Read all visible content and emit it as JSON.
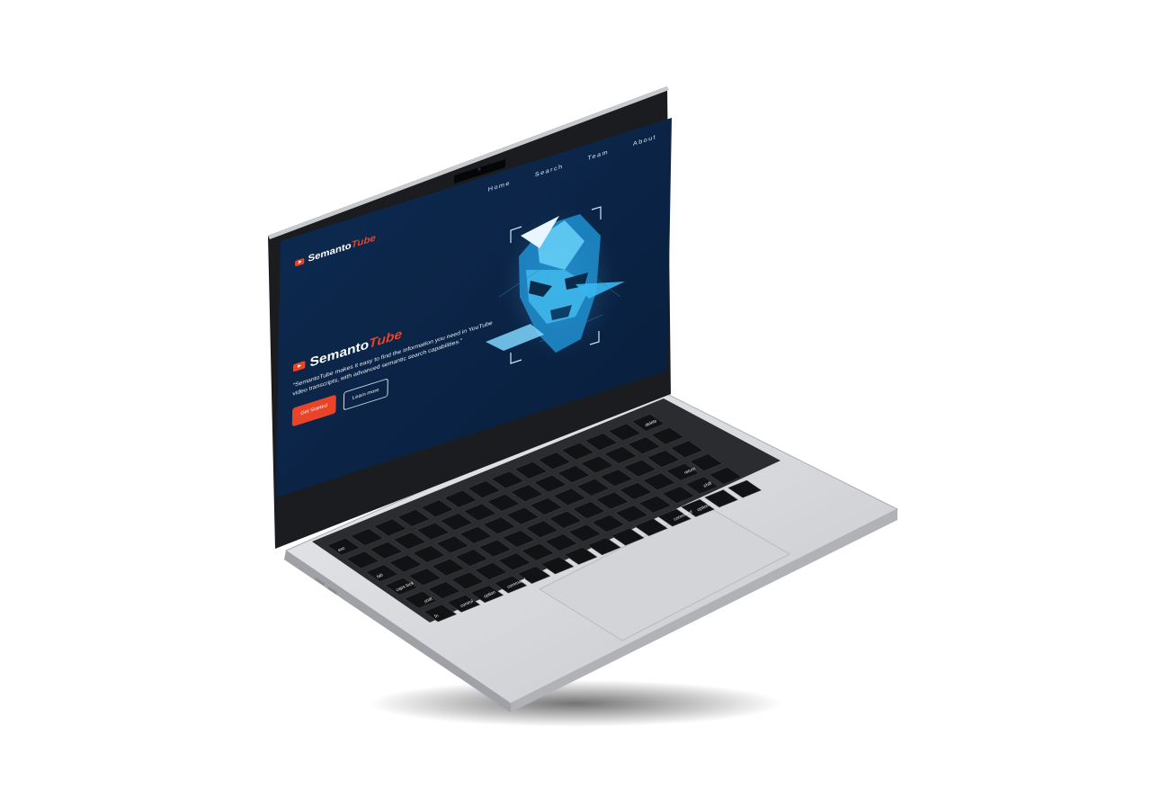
{
  "nav": {
    "items": [
      "Home",
      "Search",
      "Team",
      "About"
    ]
  },
  "brand": {
    "name_main": "Semanto",
    "name_accent": "Tube"
  },
  "hero": {
    "title_main": "Semanto",
    "title_accent": "Tube",
    "description": "\"SemantoTube makes it easy to find the information you need in YouTube video transcripts, with advanced semantic search capabilities.\"",
    "cta_primary": "Get Started",
    "cta_secondary": "Learn more"
  },
  "keyboard": {
    "labels": [
      "esc",
      "tab",
      "caps lock",
      "shift",
      "fn",
      "control",
      "option",
      "command",
      "command",
      "option",
      "return",
      "shift",
      "delete"
    ]
  },
  "colors": {
    "accent": "#e8442a",
    "screen_bg": "#0b2548",
    "face": "#2aa9e8"
  }
}
